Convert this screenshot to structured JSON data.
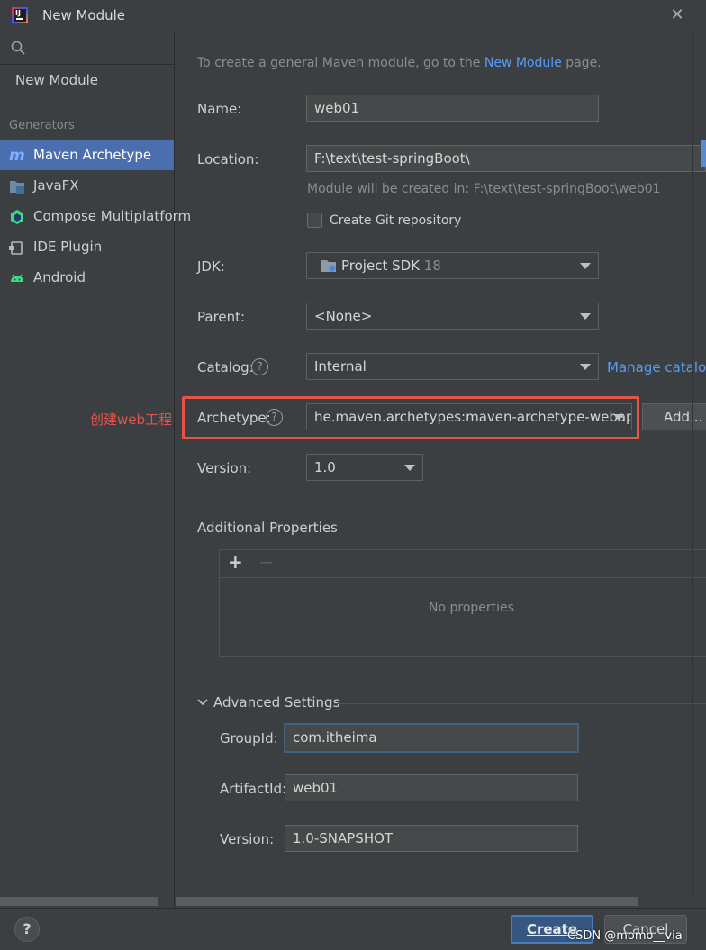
{
  "window": {
    "title": "New Module",
    "logo_text": "IJ"
  },
  "sidebar": {
    "top_item": "New Module",
    "section_label": "Generators",
    "items": [
      {
        "label": "Maven Archetype",
        "icon": "maven-icon",
        "selected": true
      },
      {
        "label": "JavaFX",
        "icon": "javafx-folder-icon"
      },
      {
        "label": "Compose Multiplatform",
        "icon": "compose-icon"
      },
      {
        "label": "IDE Plugin",
        "icon": "plugin-icon"
      },
      {
        "label": "Android",
        "icon": "android-icon"
      }
    ]
  },
  "form": {
    "intro_prefix": "To create a general Maven module, go to the ",
    "intro_link": "New Module",
    "intro_suffix": " page.",
    "name_label": "Name:",
    "name_value": "web01",
    "location_label": "Location:",
    "location_value": "F:\\text\\test-springBoot\\",
    "location_hint": "Module will be created in: F:\\text\\test-springBoot\\web01",
    "git_checkbox_label": "Create Git repository",
    "git_checked": false,
    "jdk_label": "JDK:",
    "jdk_value": "Project SDK",
    "jdk_version": "18",
    "parent_label": "Parent:",
    "parent_value": "<None>",
    "catalog_label": "Catalog:",
    "catalog_value": "Internal",
    "manage_catalogs_link": "Manage catalog",
    "archetype_label": "Archetype:",
    "archetype_value": "he.maven.archetypes:maven-archetype-webapp",
    "archetype_add_button": "Add...",
    "version_label": "Version:",
    "version_value": "1.0",
    "help_glyph": "?"
  },
  "annotation": {
    "text": "创建web工程",
    "color": "#e5534b"
  },
  "additional_properties": {
    "title": "Additional Properties",
    "add_glyph": "+",
    "remove_glyph": "−",
    "empty_text": "No properties"
  },
  "advanced": {
    "title": "Advanced Settings",
    "groupid_label": "GroupId:",
    "groupid_value": "com.itheima",
    "artifactid_label": "ArtifactId:",
    "artifactid_value": "web01",
    "version_label": "Version:",
    "version_value": "1.0-SNAPSHOT"
  },
  "footer": {
    "help_glyph": "?",
    "create_label": "Create",
    "cancel_label": "Cancel",
    "watermark": "CSDN @momo__via"
  },
  "colors": {
    "accent": "#4b6eaf",
    "link": "#589df6",
    "background": "#3c3f41",
    "highlight": "#e5534b"
  }
}
